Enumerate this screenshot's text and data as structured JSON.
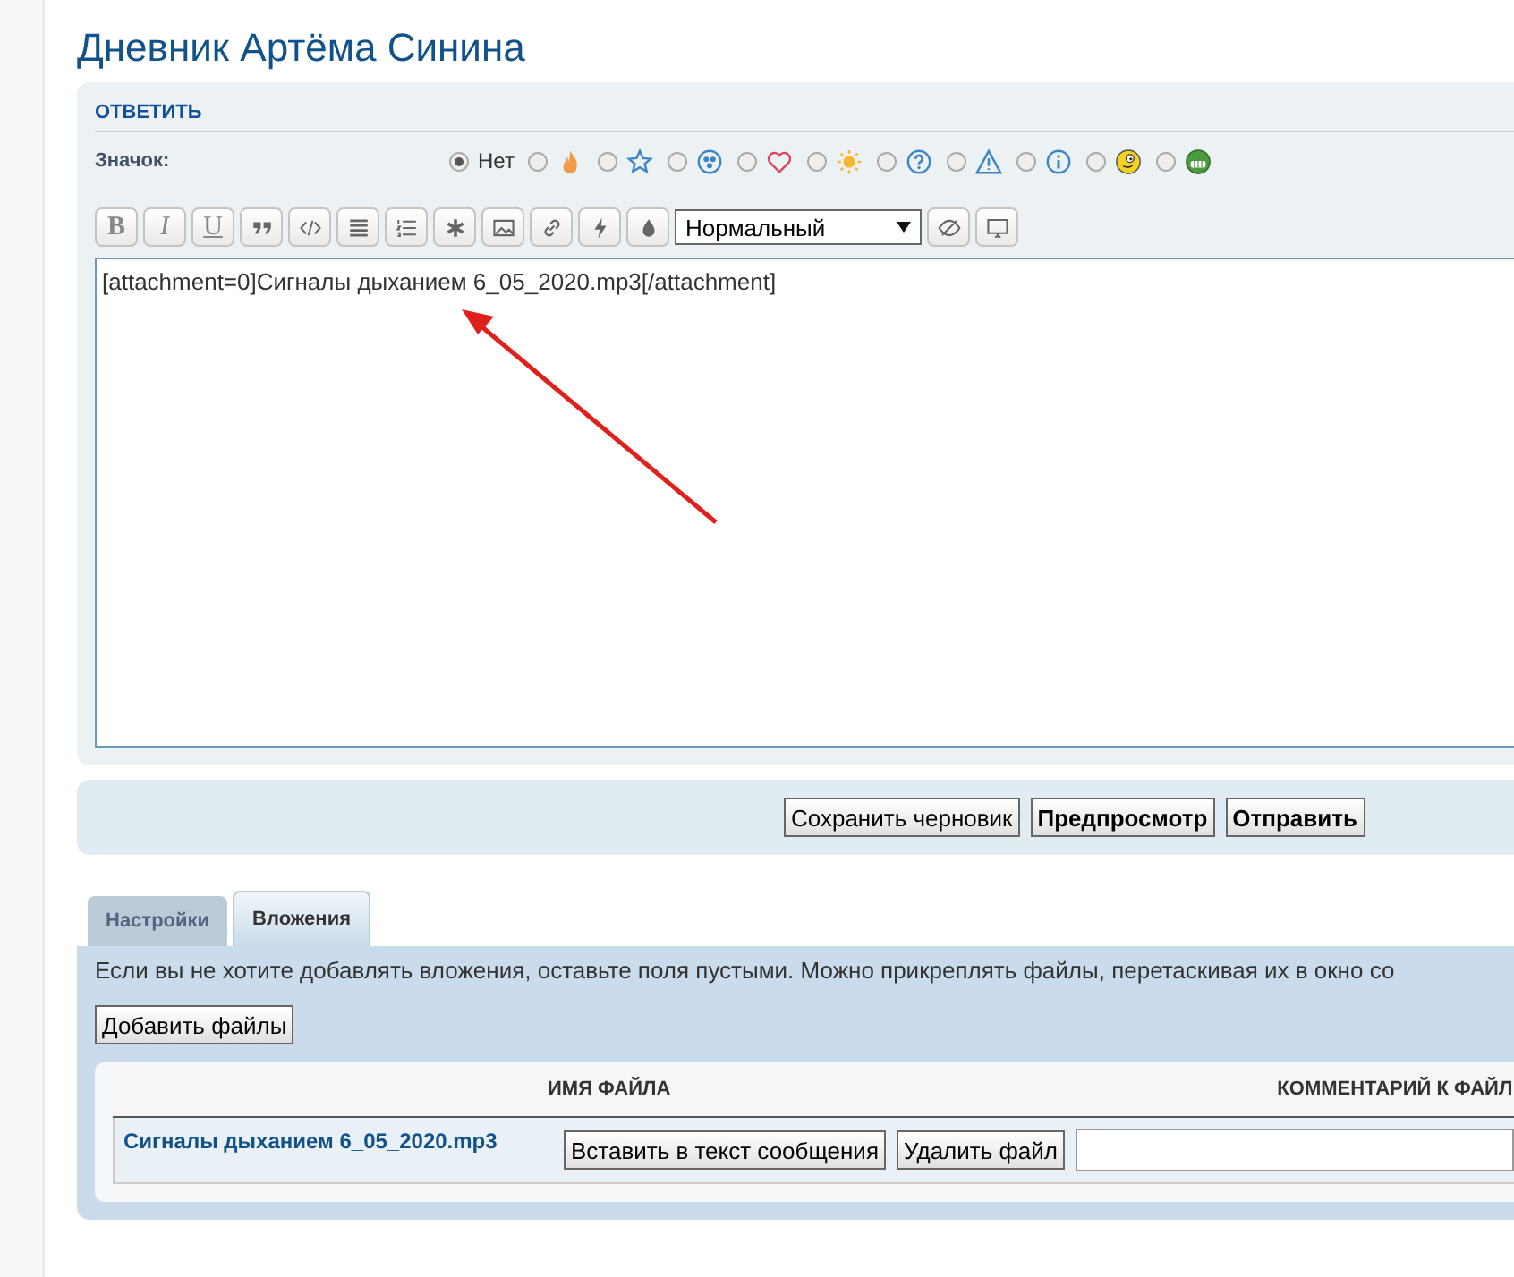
{
  "title": "Дневник Артёма Синина",
  "reply": {
    "heading": "ОТВЕТИТЬ",
    "icon_label": "Значок:",
    "icon_options": [
      {
        "kind": "none",
        "label": "Нет",
        "selected": true
      },
      {
        "kind": "fire",
        "selected": false
      },
      {
        "kind": "star",
        "selected": false
      },
      {
        "kind": "radiation",
        "selected": false
      },
      {
        "kind": "heart",
        "selected": false
      },
      {
        "kind": "sun",
        "selected": false
      },
      {
        "kind": "question",
        "selected": false
      },
      {
        "kind": "warning",
        "selected": false
      },
      {
        "kind": "info",
        "selected": false
      },
      {
        "kind": "smiley",
        "selected": false
      },
      {
        "kind": "grin",
        "selected": false
      }
    ],
    "toolbar": [
      {
        "kind": "bold",
        "label": "B"
      },
      {
        "kind": "italic",
        "label": "I"
      },
      {
        "kind": "underline",
        "label": "U"
      },
      {
        "kind": "quote"
      },
      {
        "kind": "code"
      },
      {
        "kind": "list"
      },
      {
        "kind": "numbered-list"
      },
      {
        "kind": "asterisk"
      },
      {
        "kind": "image"
      },
      {
        "kind": "link"
      },
      {
        "kind": "lightning"
      },
      {
        "kind": "drop"
      },
      {
        "kind": "select",
        "value": "Нормальный"
      },
      {
        "kind": "eye-slash"
      },
      {
        "kind": "monitor"
      }
    ],
    "message": "[attachment=0]Сигналы дыханием 6_05_2020.mp3[/attachment]",
    "buttons": [
      {
        "label": "Сохранить черновик",
        "primary": false
      },
      {
        "label": "Предпросмотр",
        "primary": true
      },
      {
        "label": "Отправить",
        "primary": true
      }
    ]
  },
  "tabs": [
    {
      "label": "Настройки",
      "selected": false
    },
    {
      "label": "Вложения",
      "selected": true
    }
  ],
  "attachments": {
    "hint": "Если вы не хотите добавлять вложения, оставьте поля пустыми. Можно прикреплять файлы, перетаскивая их в окно со",
    "add_button": "Добавить файлы",
    "columns": [
      "ИМЯ ФАЙЛА",
      "КОММЕНТАРИЙ К ФАЙЛ"
    ],
    "files": [
      {
        "name": "Сигналы дыханием 6_05_2020.mp3",
        "insert_button": "Вставить в текст сообщения",
        "delete_button": "Удалить файл"
      }
    ]
  }
}
